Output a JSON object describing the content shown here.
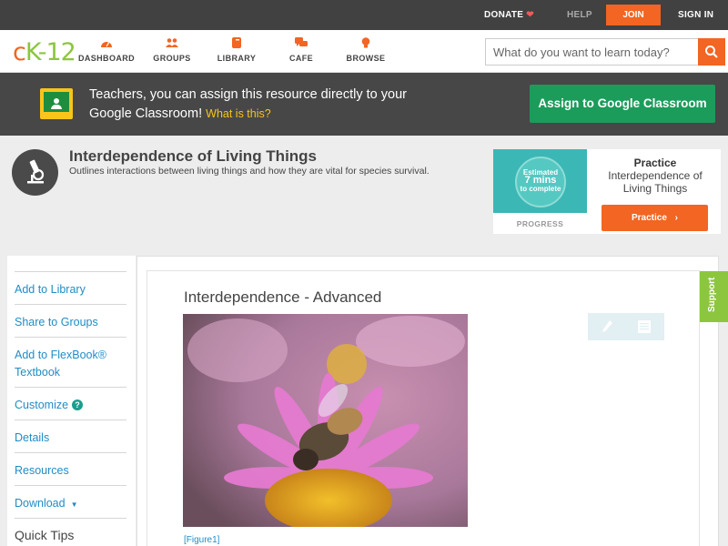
{
  "topbar": {
    "donate": "DONATE",
    "help": "HELP",
    "join": "JOIN",
    "signin": "SIGN IN"
  },
  "logo": {
    "text_c": "c",
    "text_k": "K",
    "text_dash": "-",
    "text_12": "12"
  },
  "nav": {
    "items": [
      {
        "label": "DASHBOARD",
        "icon": "gauge-icon"
      },
      {
        "label": "GROUPS",
        "icon": "users-icon"
      },
      {
        "label": "LIBRARY",
        "icon": "book-icon"
      },
      {
        "label": "CAFE",
        "icon": "chat-icon"
      },
      {
        "label": "BROWSE",
        "icon": "lightbulb-icon"
      }
    ],
    "search_placeholder": "What do you want to learn today?"
  },
  "banner": {
    "text": "Teachers, you can assign this resource directly to your Google Classroom!",
    "what_is_this": "What is this?",
    "assign_button": "Assign to Google Classroom"
  },
  "page": {
    "title": "Interdependence of Living Things",
    "description": "Outlines interactions between living things and how they are vital for species survival."
  },
  "practice_card": {
    "estimated": "Estimated",
    "mins": "7 mins",
    "to_complete": "to complete",
    "progress_label": "PROGRESS",
    "title": "Practice",
    "subtitle": "Interdependence of Living Things",
    "button": "Practice"
  },
  "sidebar": {
    "items": [
      "Add to Library",
      "Share to Groups",
      "Add to FlexBook® Textbook",
      "Customize",
      "Details",
      "Resources",
      "Download"
    ],
    "quick_tips": "Quick Tips"
  },
  "content": {
    "section_title": "Interdependence - Advanced",
    "figure_link": "[Figure1]",
    "support": "Support"
  },
  "colors": {
    "accent_orange": "#f26522",
    "brand_green": "#8cc63f",
    "link_blue": "#1f8dc6",
    "classroom_green": "#1b9c5a"
  }
}
